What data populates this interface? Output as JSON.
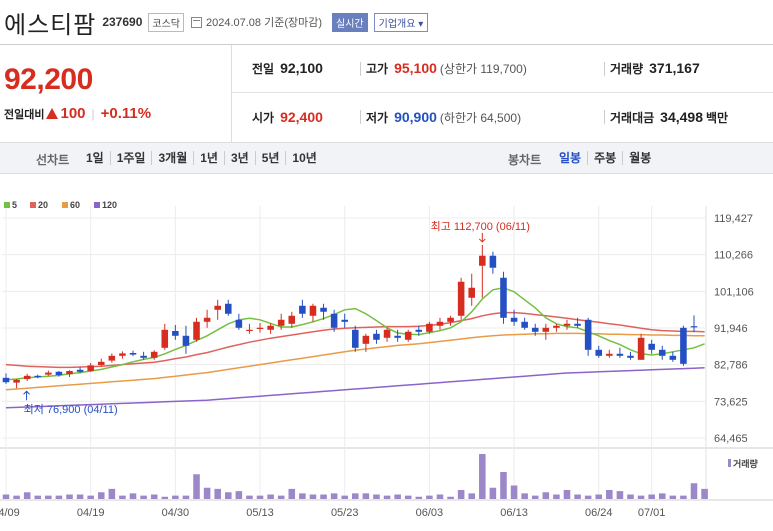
{
  "header": {
    "name": "에스티팜",
    "code": "237690",
    "market": "코스닥",
    "date_label": "2024.07.08  기준(장마감)",
    "live_tag": "실시간",
    "info_tag": "기업개요 ▾"
  },
  "price": {
    "current": "92,200",
    "diff_label": "전일대비",
    "diff_value": "100",
    "diff_pct": "+0.11%"
  },
  "stats": {
    "prev_label": "전일",
    "prev": "92,100",
    "high_label": "고가",
    "high": "95,100",
    "upper": "(상한가 119,700)",
    "volume_label": "거래량",
    "volume": "371,167",
    "open_label": "시가",
    "open": "92,400",
    "low_label": "저가",
    "low": "90,900",
    "lower": "(하한가 64,500)",
    "amount_label": "거래대금",
    "amount": "34,498",
    "amount_unit": "백만"
  },
  "toolbar": {
    "line_label": "선차트",
    "line_periods": [
      "1일",
      "1주일",
      "3개월",
      "1년",
      "3년",
      "5년",
      "10년"
    ],
    "candle_label": "봉차트",
    "candle_periods": [
      "일봉",
      "주봉",
      "월봉"
    ],
    "active_candle": "일봉"
  },
  "colors": {
    "up": "#d62d20",
    "down": "#2450c4",
    "ma5": "#74c042",
    "ma20": "#e0625c",
    "ma60": "#e89c47",
    "ma120": "#8a64c8",
    "volume": "#9c88c8"
  },
  "chart_data": {
    "type": "candlestick",
    "legend": [
      {
        "name": "5",
        "color": "#74c042"
      },
      {
        "name": "20",
        "color": "#e0625c"
      },
      {
        "name": "60",
        "color": "#e89c47"
      },
      {
        "name": "120",
        "color": "#8a64c8"
      }
    ],
    "y_ticks": [
      "119,427",
      "110,266",
      "101,106",
      "91,946",
      "82,786",
      "73,625",
      "64,465"
    ],
    "ylim": [
      64465,
      119427
    ],
    "x_labels": [
      "04/09",
      "04/19",
      "04/30",
      "05/13",
      "05/23",
      "06/03",
      "06/13",
      "06/24",
      "07/01"
    ],
    "x_label_index": [
      0,
      8,
      16,
      24,
      32,
      40,
      48,
      56,
      61
    ],
    "annotations": {
      "high": {
        "text": "최고 112,700 (06/11)",
        "value": 112700,
        "index": 45
      },
      "low": {
        "text": "최저 76,900 (04/11)",
        "value": 76900,
        "index": 1
      }
    },
    "volume_label": "거래량",
    "candles": [
      {
        "o": 79500,
        "h": 80600,
        "l": 78000,
        "c": 78400
      },
      {
        "o": 78300,
        "h": 79200,
        "l": 76900,
        "c": 79000
      },
      {
        "o": 79200,
        "h": 80500,
        "l": 78700,
        "c": 80000
      },
      {
        "o": 80000,
        "h": 80300,
        "l": 79400,
        "c": 79700
      },
      {
        "o": 80300,
        "h": 81300,
        "l": 80000,
        "c": 80800
      },
      {
        "o": 81000,
        "h": 81200,
        "l": 79800,
        "c": 80200
      },
      {
        "o": 80400,
        "h": 81400,
        "l": 79700,
        "c": 81200
      },
      {
        "o": 81500,
        "h": 82200,
        "l": 80600,
        "c": 81000
      },
      {
        "o": 81200,
        "h": 83200,
        "l": 81000,
        "c": 82600
      },
      {
        "o": 82700,
        "h": 84300,
        "l": 82300,
        "c": 83500
      },
      {
        "o": 83800,
        "h": 85600,
        "l": 83300,
        "c": 85000
      },
      {
        "o": 85000,
        "h": 86100,
        "l": 84300,
        "c": 85600
      },
      {
        "o": 85700,
        "h": 86300,
        "l": 84900,
        "c": 85300
      },
      {
        "o": 85000,
        "h": 86000,
        "l": 84000,
        "c": 84500
      },
      {
        "o": 84500,
        "h": 86400,
        "l": 84000,
        "c": 86000
      },
      {
        "o": 87000,
        "h": 93000,
        "l": 86500,
        "c": 91500
      },
      {
        "o": 91200,
        "h": 92700,
        "l": 89000,
        "c": 90000
      },
      {
        "o": 90000,
        "h": 92500,
        "l": 85500,
        "c": 87500
      },
      {
        "o": 89000,
        "h": 94500,
        "l": 88500,
        "c": 93500
      },
      {
        "o": 93500,
        "h": 96500,
        "l": 92000,
        "c": 94500
      },
      {
        "o": 96500,
        "h": 99000,
        "l": 94000,
        "c": 97500
      },
      {
        "o": 98000,
        "h": 99000,
        "l": 95000,
        "c": 95500
      },
      {
        "o": 94000,
        "h": 95500,
        "l": 91500,
        "c": 92000
      },
      {
        "o": 91500,
        "h": 93000,
        "l": 90500,
        "c": 91500
      },
      {
        "o": 92000,
        "h": 93200,
        "l": 90800,
        "c": 92000
      },
      {
        "o": 91500,
        "h": 93200,
        "l": 90500,
        "c": 92500
      },
      {
        "o": 92500,
        "h": 95500,
        "l": 91500,
        "c": 94000
      },
      {
        "o": 93000,
        "h": 96000,
        "l": 92000,
        "c": 95000
      },
      {
        "o": 97500,
        "h": 99000,
        "l": 94500,
        "c": 95500
      },
      {
        "o": 95000,
        "h": 98000,
        "l": 93500,
        "c": 97500
      },
      {
        "o": 97000,
        "h": 98000,
        "l": 94000,
        "c": 96000
      },
      {
        "o": 95500,
        "h": 96500,
        "l": 91000,
        "c": 92000
      },
      {
        "o": 94000,
        "h": 95500,
        "l": 92000,
        "c": 93500
      },
      {
        "o": 91500,
        "h": 92500,
        "l": 86000,
        "c": 87000
      },
      {
        "o": 88000,
        "h": 90500,
        "l": 86000,
        "c": 90000
      },
      {
        "o": 90500,
        "h": 91500,
        "l": 88000,
        "c": 89000
      },
      {
        "o": 89500,
        "h": 92000,
        "l": 88500,
        "c": 91500
      },
      {
        "o": 90000,
        "h": 91500,
        "l": 88500,
        "c": 89500
      },
      {
        "o": 89000,
        "h": 91500,
        "l": 88500,
        "c": 91000
      },
      {
        "o": 91500,
        "h": 92500,
        "l": 90000,
        "c": 91000
      },
      {
        "o": 91000,
        "h": 93500,
        "l": 90500,
        "c": 93000
      },
      {
        "o": 92500,
        "h": 94500,
        "l": 91500,
        "c": 93500
      },
      {
        "o": 93500,
        "h": 95000,
        "l": 92500,
        "c": 94500
      },
      {
        "o": 95000,
        "h": 104500,
        "l": 94000,
        "c": 103500
      },
      {
        "o": 99500,
        "h": 105500,
        "l": 97500,
        "c": 102000
      },
      {
        "o": 107500,
        "h": 112700,
        "l": 99500,
        "c": 110000
      },
      {
        "o": 110000,
        "h": 111000,
        "l": 105500,
        "c": 107000
      },
      {
        "o": 104500,
        "h": 106000,
        "l": 93000,
        "c": 94500
      },
      {
        "o": 94500,
        "h": 96500,
        "l": 92500,
        "c": 93500
      },
      {
        "o": 93500,
        "h": 94500,
        "l": 91500,
        "c": 92000
      },
      {
        "o": 92000,
        "h": 93000,
        "l": 90000,
        "c": 91000
      },
      {
        "o": 91000,
        "h": 93000,
        "l": 89000,
        "c": 92000
      },
      {
        "o": 92000,
        "h": 93000,
        "l": 91000,
        "c": 92500
      },
      {
        "o": 92500,
        "h": 94000,
        "l": 91500,
        "c": 93000
      },
      {
        "o": 93000,
        "h": 94500,
        "l": 92000,
        "c": 92500
      },
      {
        "o": 94000,
        "h": 94500,
        "l": 85000,
        "c": 86500
      },
      {
        "o": 86500,
        "h": 87500,
        "l": 84500,
        "c": 85000
      },
      {
        "o": 85000,
        "h": 86500,
        "l": 84500,
        "c": 85500
      },
      {
        "o": 85500,
        "h": 87000,
        "l": 84500,
        "c": 85000
      },
      {
        "o": 85000,
        "h": 86000,
        "l": 84000,
        "c": 84500
      },
      {
        "o": 84000,
        "h": 90500,
        "l": 84000,
        "c": 89500
      },
      {
        "o": 88000,
        "h": 89000,
        "l": 85500,
        "c": 86500
      },
      {
        "o": 86500,
        "h": 87500,
        "l": 84000,
        "c": 85000
      },
      {
        "o": 85000,
        "h": 86000,
        "l": 83500,
        "c": 84000
      },
      {
        "o": 92000,
        "h": 92500,
        "l": 82500,
        "c": 83000
      },
      {
        "o": 92400,
        "h": 95100,
        "l": 90900,
        "c": 92200
      }
    ],
    "volume": [
      4,
      3,
      6,
      3,
      3,
      3,
      4,
      4,
      3,
      6,
      9,
      3,
      5,
      3,
      4,
      2,
      3,
      3,
      22,
      10,
      9,
      6,
      7,
      3,
      3,
      4,
      3,
      9,
      5,
      4,
      4,
      5,
      3,
      5,
      5,
      4,
      3,
      4,
      3,
      2,
      3,
      4,
      2,
      8,
      5,
      40,
      10,
      24,
      12,
      5,
      3,
      6,
      4,
      8,
      4,
      3,
      4,
      8,
      7,
      4,
      3,
      4,
      5,
      3,
      3,
      14,
      9
    ],
    "ma5": [
      79000,
      79200,
      79500,
      79700,
      79900,
      80100,
      80500,
      80800,
      81200,
      81600,
      82200,
      82800,
      83500,
      84100,
      84600,
      85500,
      86600,
      87600,
      88800,
      90000,
      91500,
      93000,
      94000,
      94400,
      94000,
      93100,
      92200,
      92200,
      92800,
      93500,
      94300,
      95300,
      96500,
      96800,
      95500,
      93800,
      92000,
      90700,
      90400,
      90300,
      90800,
      91300,
      92000,
      93500,
      96000,
      99200,
      101500,
      102000,
      101000,
      99000,
      97000,
      94500,
      93000,
      92300,
      92000,
      91000,
      90000,
      88800,
      87800,
      86500,
      85500,
      85200,
      85500,
      86000,
      86500,
      87000,
      88000
    ],
    "ma20": [
      82800,
      82600,
      82400,
      82300,
      82200,
      82100,
      82100,
      82200,
      82300,
      82400,
      82600,
      82800,
      83000,
      83200,
      83400,
      83800,
      84300,
      84700,
      85300,
      85800,
      86500,
      87200,
      87800,
      88400,
      88900,
      89400,
      89800,
      90200,
      90600,
      91000,
      91400,
      91700,
      91900,
      92000,
      92100,
      92200,
      92300,
      92300,
      92300,
      92400,
      92600,
      92900,
      93300,
      93800,
      94300,
      95000,
      95500,
      95800,
      95800,
      95600,
      95300,
      95000,
      94700,
      94400,
      94000,
      93700,
      93400,
      93000,
      92700,
      92300,
      91900,
      91500,
      91300,
      91200,
      91100,
      91100,
      91000
    ],
    "ma60": [
      76500,
      76700,
      76900,
      77100,
      77300,
      77500,
      77700,
      77900,
      78100,
      78300,
      78500,
      78700,
      78900,
      79100,
      79300,
      79600,
      79900,
      80200,
      80500,
      80800,
      81200,
      81600,
      82000,
      82400,
      82800,
      83200,
      83600,
      84000,
      84400,
      84800,
      85200,
      85600,
      86000,
      86400,
      86700,
      87000,
      87300,
      87600,
      87800,
      88000,
      88300,
      88600,
      88900,
      89200,
      89500,
      89800,
      90000,
      90200,
      90300,
      90400,
      90500,
      90500,
      90600,
      90600,
      90600,
      90500,
      90500,
      90400,
      90400,
      90300,
      90300,
      90200,
      90200,
      90100,
      90100,
      90000,
      90000
    ],
    "ma120": [
      72000,
      72100,
      72200,
      72300,
      72400,
      72500,
      72600,
      72700,
      72800,
      72900,
      73000,
      73100,
      73200,
      73300,
      73400,
      73500,
      73600,
      73700,
      73800,
      73900,
      74100,
      74300,
      74500,
      74700,
      74900,
      75100,
      75300,
      75500,
      75700,
      75900,
      76100,
      76300,
      76500,
      76700,
      76900,
      77100,
      77300,
      77500,
      77700,
      77900,
      78100,
      78300,
      78500,
      78700,
      78900,
      79100,
      79300,
      79500,
      79700,
      79900,
      80100,
      80300,
      80500,
      80700,
      80800,
      80900,
      81000,
      81100,
      81200,
      81300,
      81400,
      81500,
      81600,
      81700,
      81800,
      81900,
      82000
    ]
  }
}
